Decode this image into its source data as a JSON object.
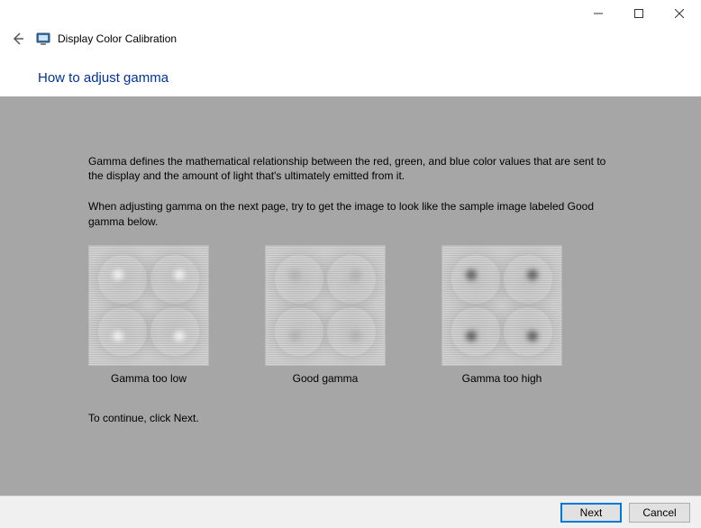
{
  "window": {
    "app_title": "Display Color Calibration"
  },
  "page": {
    "title": "How to adjust gamma",
    "paragraph1": "Gamma defines the mathematical relationship between the red, green, and blue color values that are sent to the display and the amount of light that's ultimately emitted from it.",
    "paragraph2": "When adjusting gamma on the next page, try to get the image to look like the sample image labeled Good gamma below.",
    "continue_text": "To continue, click Next."
  },
  "samples": {
    "low": "Gamma too low",
    "good": "Good gamma",
    "high": "Gamma too high"
  },
  "footer": {
    "next": "Next",
    "cancel": "Cancel"
  }
}
